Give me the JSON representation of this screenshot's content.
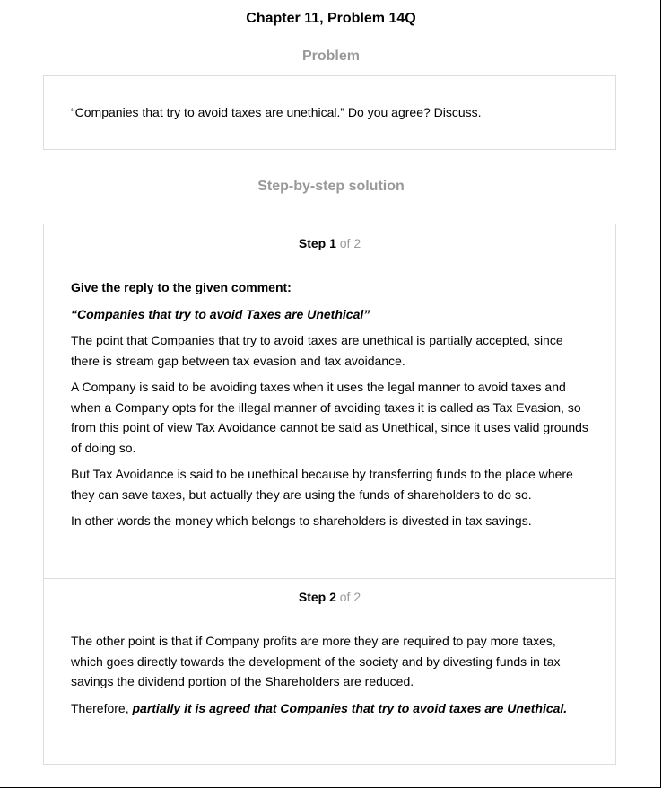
{
  "header": {
    "chapter_title": "Chapter 11, Problem 14Q"
  },
  "problem": {
    "heading": "Problem",
    "text": "“Companies that try to avoid taxes are unethical.” Do you agree? Discuss."
  },
  "solution": {
    "heading": "Step-by-step solution",
    "steps": [
      {
        "label": "Step 1",
        "of": "of 2",
        "heading": "Give the reply to the given comment:",
        "quote": "“Companies that try to avoid Taxes are Unethical”",
        "paragraphs": [
          "The point that Companies that try to avoid taxes are unethical is partially accepted, since there is stream gap between tax evasion and tax avoidance.",
          "A Company is said to be avoiding taxes when it uses the legal manner to avoid taxes and when a Company opts for the illegal manner of avoiding taxes it is called as Tax Evasion, so from this point of view Tax Avoidance cannot be said as Unethical, since it uses valid grounds of doing so.",
          "But Tax Avoidance is said to be unethical because by transferring funds to the place where they can save taxes, but actually they are using the funds of shareholders to do so.",
          "In other words the money which belongs to shareholders is divested in tax savings."
        ]
      },
      {
        "label": "Step 2",
        "of": "of 2",
        "paragraphs": [
          "The other point is that if Company profits are more they are required to pay more taxes, which goes directly towards the development of the society and by divesting funds in tax savings the dividend portion of the Shareholders are reduced."
        ],
        "conclusion_prefix": "Therefore, ",
        "conclusion_emphasis": "partially it is agreed that Companies that try to avoid taxes are Unethical."
      }
    ]
  }
}
